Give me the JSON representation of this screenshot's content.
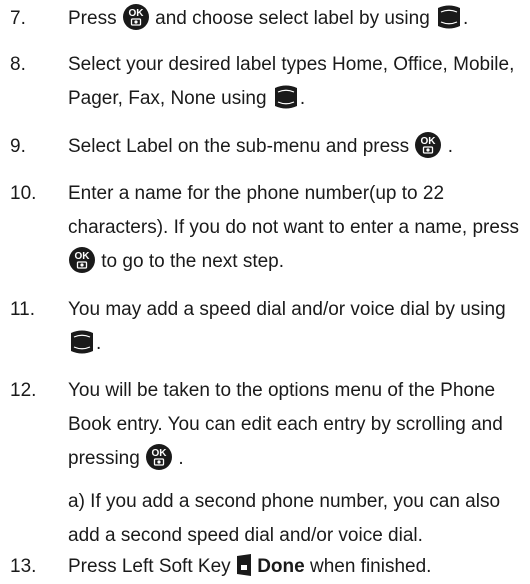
{
  "steps": [
    {
      "num": "7.",
      "parts": [
        "Press ",
        " and choose select label by using ",
        "."
      ]
    },
    {
      "num": "8.",
      "parts": [
        "Select your desired label types Home, Office, Mobile, Pager, Fax, None using ",
        "."
      ]
    },
    {
      "num": "9.",
      "parts": [
        "Select Label on the sub-menu and press ",
        " ."
      ]
    },
    {
      "num": "10.",
      "parts": [
        "Enter a name for the phone number(up to 22 characters). If you do not want to enter a name, press ",
        " to go to the next step."
      ]
    },
    {
      "num": "11.",
      "parts": [
        "You may add a speed dial and/or voice dial by using ",
        "."
      ]
    },
    {
      "num": "12.",
      "parts": [
        "You will be taken to the options menu of the Phone Book entry. You can edit each entry by scrolling and pressing ",
        " ."
      ]
    },
    {
      "num": "13.",
      "parts": [
        "Press Left Soft Key ",
        "Done",
        " when finished."
      ]
    }
  ],
  "note_12a": "a) If you add a second phone number, you can also add a second speed dial and/or voice dial.",
  "icons": {
    "ok": {
      "label": "OK",
      "name": "ok-camera-key-icon",
      "color": "#1a1a1a"
    },
    "nav": {
      "name": "navigation-key-icon",
      "color": "#1a1a1a"
    },
    "softkey": {
      "name": "left-soft-key-icon",
      "color": "#1a1a1a"
    }
  }
}
